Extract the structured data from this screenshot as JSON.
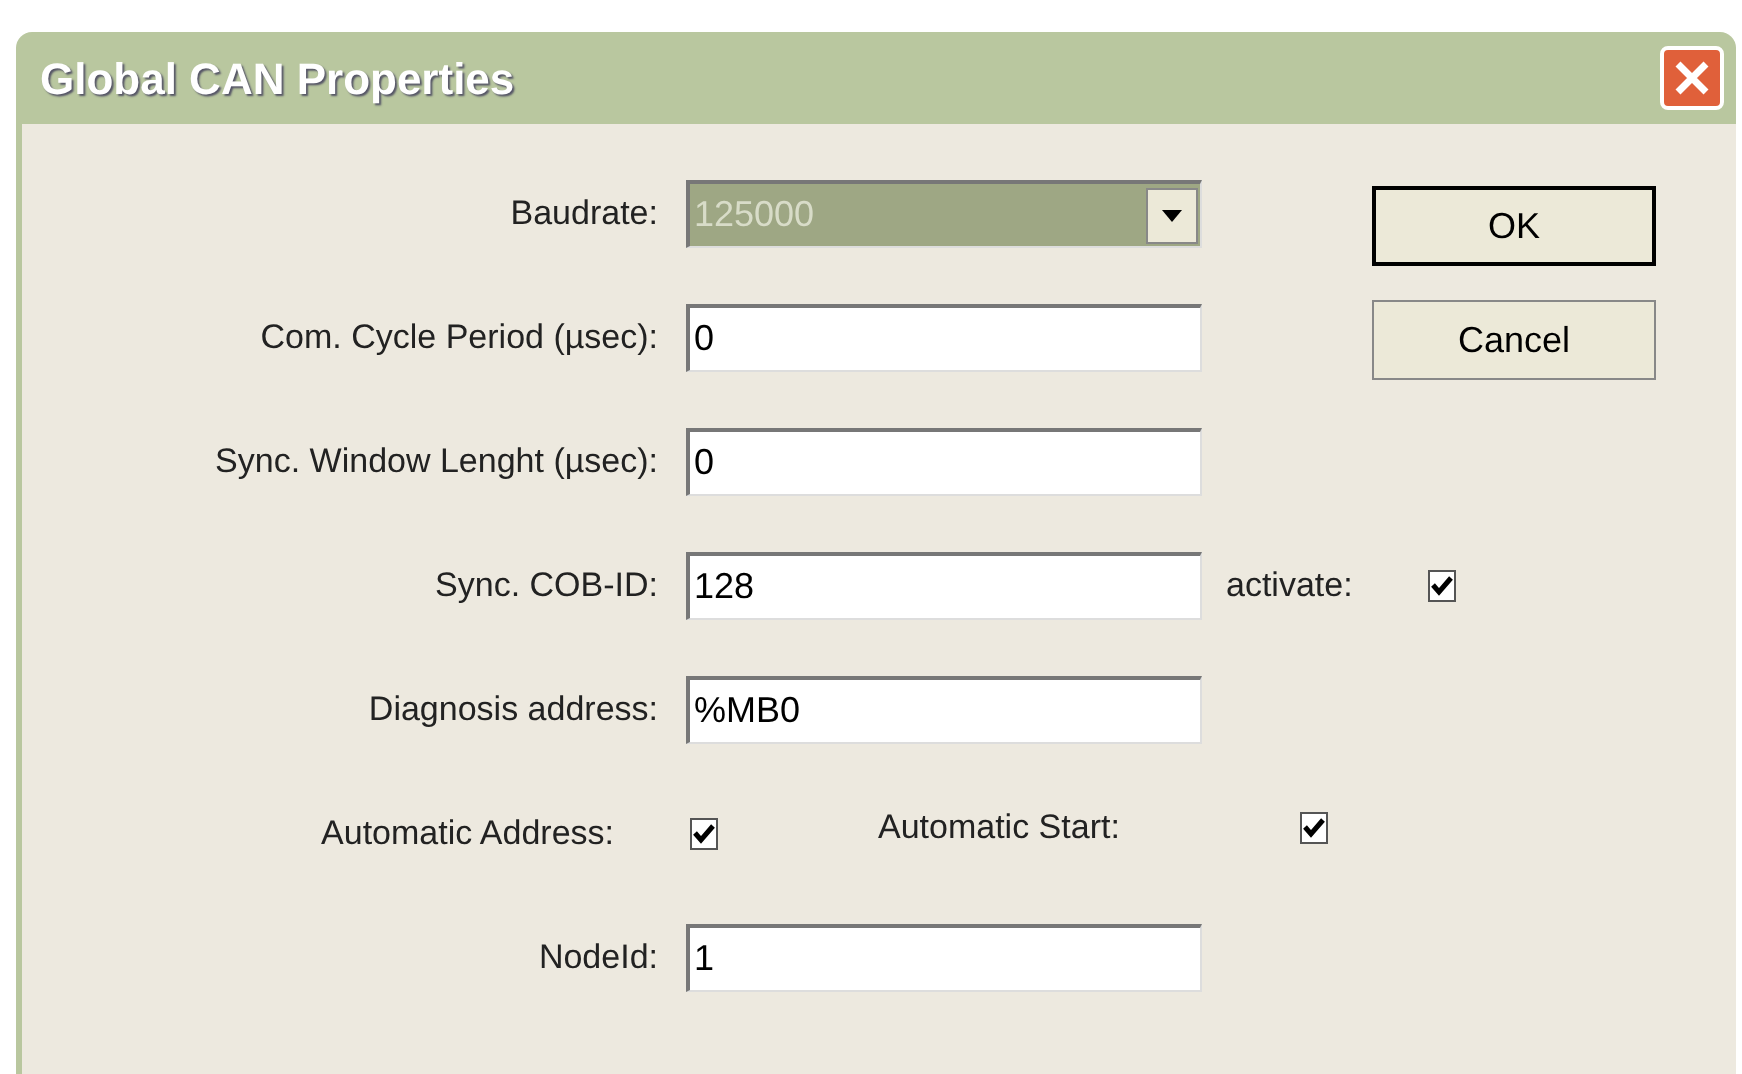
{
  "window": {
    "title": "Global CAN Properties"
  },
  "fields": [
    {
      "kind": "dropdown",
      "label": "Baudrate:",
      "value": "125000",
      "disabled": true
    },
    {
      "kind": "text",
      "label": "Com. Cycle Period (µsec):",
      "value": "0"
    },
    {
      "kind": "text",
      "label": "Sync. Window Lenght (µsec):",
      "value": "0"
    },
    {
      "kind": "text",
      "label": "Sync. COB-ID:",
      "value": "128",
      "checkbox": {
        "label": "activate:",
        "checked": true
      }
    },
    {
      "kind": "text",
      "label": "Diagnosis address:",
      "value": "%MB0"
    },
    {
      "kind": "checks",
      "items": [
        {
          "label": "Automatic Address:",
          "checked": true
        },
        {
          "label": "Automatic Start:",
          "checked": true
        }
      ]
    },
    {
      "kind": "text",
      "label": "NodeId:",
      "value": "1"
    }
  ],
  "buttons": [
    {
      "label": "OK",
      "default": true
    },
    {
      "label": "Cancel",
      "default": false
    }
  ]
}
